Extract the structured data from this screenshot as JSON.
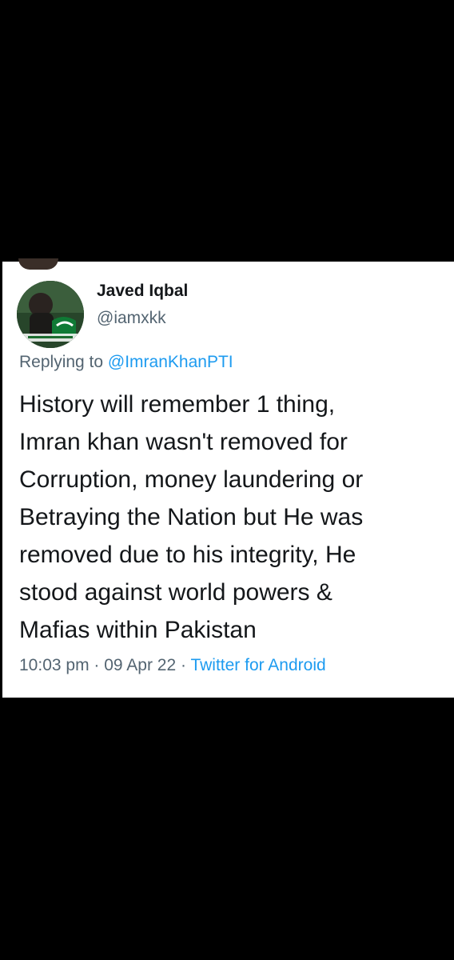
{
  "tweet": {
    "author": {
      "display_name": "Javed Iqbal",
      "handle": "@iamxkk",
      "avatar_icon": "profile-photo-avatar"
    },
    "reply": {
      "prefix": "Replying to ",
      "mention": "@ImranKhanPTI"
    },
    "text_lines": [
      "History will remember 1 thing,",
      "Imran khan wasn't removed for",
      "Corruption, money laundering or",
      "Betraying the Nation but He was",
      "removed due to his integrity, He",
      "stood against world powers &",
      "Mafias within Pakistan"
    ],
    "meta": {
      "time": "10:03 pm",
      "separator": " · ",
      "date": "09 Apr 22",
      "source": "Twitter for Android"
    }
  },
  "colors": {
    "background": "#000000",
    "card": "#ffffff",
    "text": "#14171a",
    "secondary": "#536471",
    "link": "#1d9bf0"
  }
}
